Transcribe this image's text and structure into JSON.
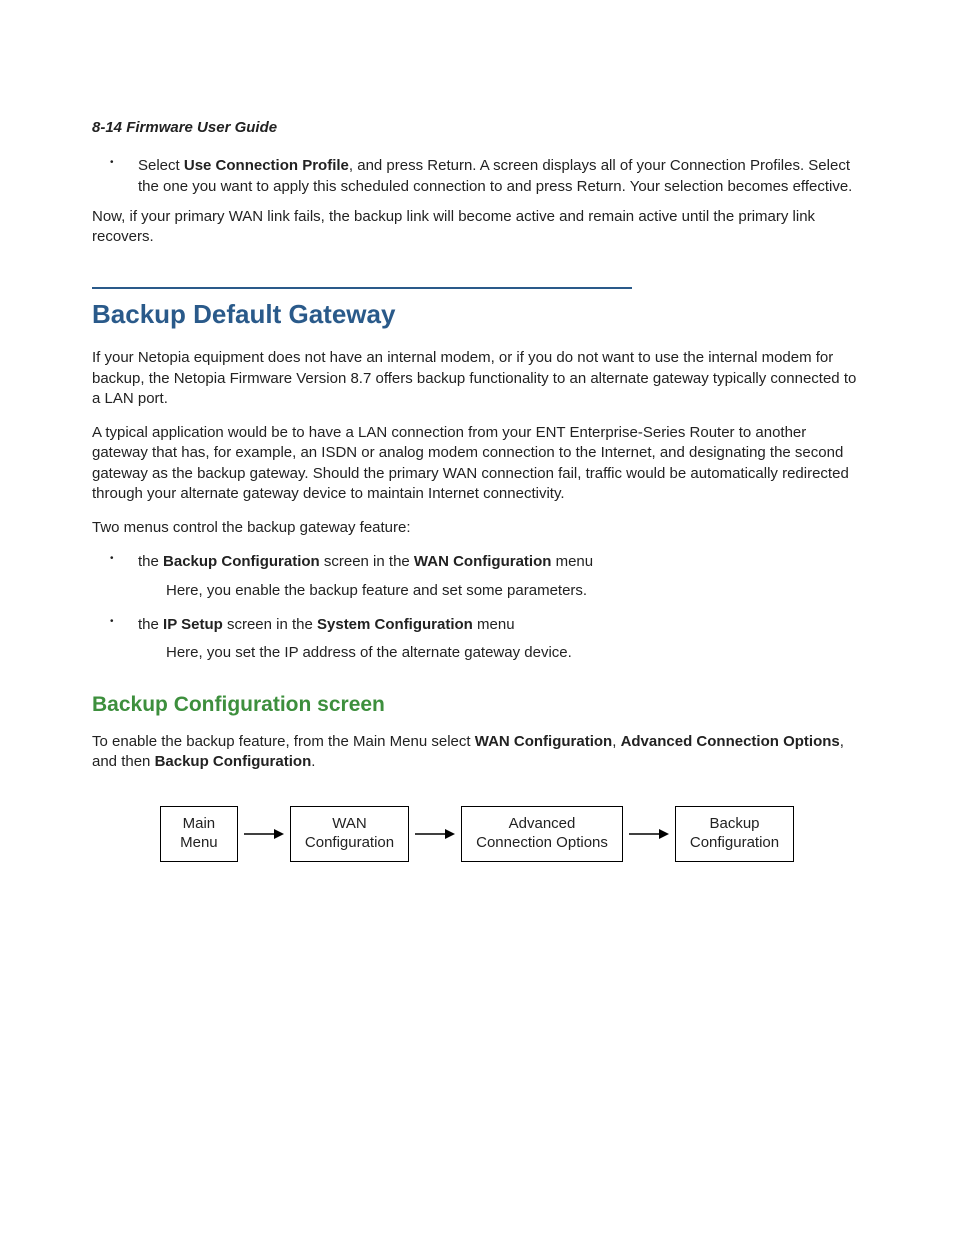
{
  "header": "8-14  Firmware User Guide",
  "bullet1_pre": "Select ",
  "bullet1_bold": "Use Connection Profile",
  "bullet1_post": ", and press Return. A screen displays all of your Connection Profiles. Select the one you want to apply this scheduled connection to and press Return. Your selection becomes effective.",
  "para_after_bullet": "Now, if your primary WAN link fails, the backup link will become active and remain active until the primary link recovers.",
  "section_title": "Backup Default Gateway",
  "sec_para1": "If your Netopia equipment does not have an internal modem, or if you do not want to use the internal modem for backup, the Netopia Firmware Version 8.7 offers backup functionality to an alternate gateway typically connected to a LAN port.",
  "sec_para2": "A typical application would be to have a LAN connection from your ENT Enterprise-Series Router to another gateway that has, for example, an ISDN or analog modem connection to the Internet, and designating the second gateway as the backup gateway. Should the primary WAN connection fail, traffic would be automatically redirected through your alternate gateway device to maintain Internet connectivity.",
  "sec_para3": "Two menus control the backup gateway feature:",
  "li2_pre": "the ",
  "li2_b1": "Backup Configuration",
  "li2_mid": " screen in the ",
  "li2_b2": "WAN Configuration",
  "li2_post": " menu",
  "li2_sub": "Here, you enable the backup feature and set some parameters.",
  "li3_pre": "the ",
  "li3_b1": "IP Setup",
  "li3_mid": " screen in the ",
  "li3_b2": "System Configuration",
  "li3_post": " menu",
  "li3_sub": "Here, you set the IP address of the alternate gateway device.",
  "subsection_title": "Backup Configuration screen",
  "sub_para_pre": "To enable the backup feature, from the Main Menu select ",
  "sub_b1": "WAN Configuration",
  "sub_sep1": ", ",
  "sub_b2": "Advanced Connection Options",
  "sub_sep2": ", and then ",
  "sub_b3": "Backup Configuration",
  "sub_post": ".",
  "diagram": {
    "box1_l1": "Main",
    "box1_l2": "Menu",
    "box2_l1": "WAN",
    "box2_l2": "Configuration",
    "box3_l1": "Advanced",
    "box3_l2": "Connection Options",
    "box4_l1": "Backup",
    "box4_l2": "Configuration"
  }
}
